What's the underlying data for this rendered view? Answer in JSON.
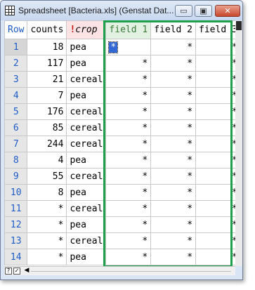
{
  "window": {
    "title": "Spreadsheet [Bacteria.xls] (Genstat Dat...",
    "min_symbol": "▭",
    "max_symbol": "▣",
    "close_symbol": "✕"
  },
  "columns": {
    "row": "Row",
    "counts": "counts",
    "crop_marker": "!",
    "crop": "crop",
    "field1": "field 1",
    "field2": "field 2",
    "field3": "field 3"
  },
  "rows": [
    {
      "row": "1",
      "counts": "18",
      "crop": "pea",
      "f1": "*",
      "f2": "*",
      "f3": "*"
    },
    {
      "row": "2",
      "counts": "117",
      "crop": "pea",
      "f1": "*",
      "f2": "*",
      "f3": "*"
    },
    {
      "row": "3",
      "counts": "21",
      "crop": "cereal",
      "f1": "*",
      "f2": "*",
      "f3": "*"
    },
    {
      "row": "4",
      "counts": "7",
      "crop": "pea",
      "f1": "*",
      "f2": "*",
      "f3": "*"
    },
    {
      "row": "5",
      "counts": "176",
      "crop": "cereal",
      "f1": "*",
      "f2": "*",
      "f3": "*"
    },
    {
      "row": "6",
      "counts": "85",
      "crop": "cereal",
      "f1": "*",
      "f2": "*",
      "f3": "*"
    },
    {
      "row": "7",
      "counts": "244",
      "crop": "cereal",
      "f1": "*",
      "f2": "*",
      "f3": "*"
    },
    {
      "row": "8",
      "counts": "4",
      "crop": "pea",
      "f1": "*",
      "f2": "*",
      "f3": "*"
    },
    {
      "row": "9",
      "counts": "55",
      "crop": "cereal",
      "f1": "*",
      "f2": "*",
      "f3": "*"
    },
    {
      "row": "10",
      "counts": "8",
      "crop": "pea",
      "f1": "*",
      "f2": "*",
      "f3": "*"
    },
    {
      "row": "11",
      "counts": "*",
      "crop": "cereal",
      "f1": "*",
      "f2": "*",
      "f3": "*"
    },
    {
      "row": "12",
      "counts": "*",
      "crop": "pea",
      "f1": "*",
      "f2": "*",
      "f3": "*"
    },
    {
      "row": "13",
      "counts": "*",
      "crop": "cereal",
      "f1": "*",
      "f2": "*",
      "f3": "*"
    },
    {
      "row": "14",
      "counts": "*",
      "crop": "pea",
      "f1": "*",
      "f2": "*",
      "f3": "*"
    }
  ],
  "scrollbar": {
    "help_symbol": "?",
    "check_symbol": "✓",
    "left_arrow": "◀"
  },
  "colors": {
    "highlight_border": "#1fa04c",
    "row_header_text": "#1e5cc8",
    "crop_header_bg": "#fde3e3",
    "factor_marker": "#c21818",
    "active_cell_bg": "#3168d6"
  }
}
